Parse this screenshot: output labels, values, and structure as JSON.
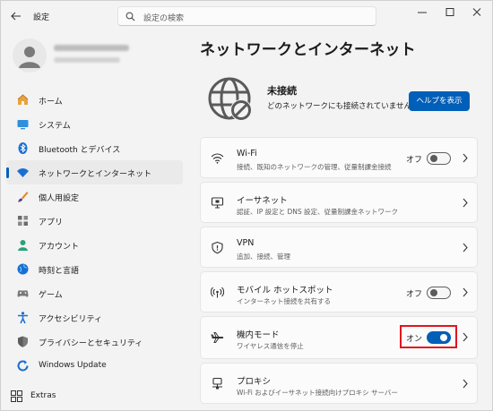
{
  "window": {
    "app_title": "設定",
    "search_placeholder": "設定の検索"
  },
  "sidebar": {
    "items": [
      {
        "label": "ホーム",
        "icon": "home-icon",
        "active": false
      },
      {
        "label": "システム",
        "icon": "system-icon",
        "active": false
      },
      {
        "label": "Bluetooth とデバイス",
        "icon": "bluetooth-icon",
        "active": false
      },
      {
        "label": "ネットワークとインターネット",
        "icon": "network-icon",
        "active": true
      },
      {
        "label": "個人用設定",
        "icon": "brush-icon",
        "active": false
      },
      {
        "label": "アプリ",
        "icon": "apps-icon",
        "active": false
      },
      {
        "label": "アカウント",
        "icon": "account-icon",
        "active": false
      },
      {
        "label": "時刻と言語",
        "icon": "globe-icon",
        "active": false
      },
      {
        "label": "ゲーム",
        "icon": "gamepad-icon",
        "active": false
      },
      {
        "label": "アクセシビリティ",
        "icon": "accessibility-icon",
        "active": false
      },
      {
        "label": "プライバシーとセキュリティ",
        "icon": "shield-icon",
        "active": false
      },
      {
        "label": "Windows Update",
        "icon": "update-icon",
        "active": false
      }
    ],
    "extras_label": "Extras"
  },
  "main": {
    "title": "ネットワークとインターネット",
    "status": {
      "title": "未接続",
      "description": "どのネットワークにも接続されていません。",
      "help_button": "ヘルプを表示"
    },
    "cards": [
      {
        "title": "Wi-Fi",
        "description": "接続、既知のネットワークの管理、従量制課金接続",
        "icon": "wifi-icon",
        "toggle": "オフ",
        "toggle_on": false
      },
      {
        "title": "イーサネット",
        "description": "認証、IP 設定と DNS 設定、従量制課金ネットワーク",
        "icon": "ethernet-icon",
        "toggle": null,
        "toggle_on": null
      },
      {
        "title": "VPN",
        "description": "追加、接続、管理",
        "icon": "vpn-shield-icon",
        "toggle": null,
        "toggle_on": null
      },
      {
        "title": "モバイル ホットスポット",
        "description": "インターネット接続を共有する",
        "icon": "hotspot-icon",
        "toggle": "オフ",
        "toggle_on": false
      },
      {
        "title": "機内モード",
        "description": "ワイヤレス通信を停止",
        "icon": "airplane-icon",
        "toggle": "オン",
        "toggle_on": true
      },
      {
        "title": "プロキシ",
        "description": "Wi-Fi およびイーサネット接続向けプロキシ サーバー",
        "icon": "proxy-icon",
        "toggle": null,
        "toggle_on": null
      }
    ]
  },
  "colors": {
    "accent": "#005fb8",
    "highlight": "#e0141e"
  }
}
